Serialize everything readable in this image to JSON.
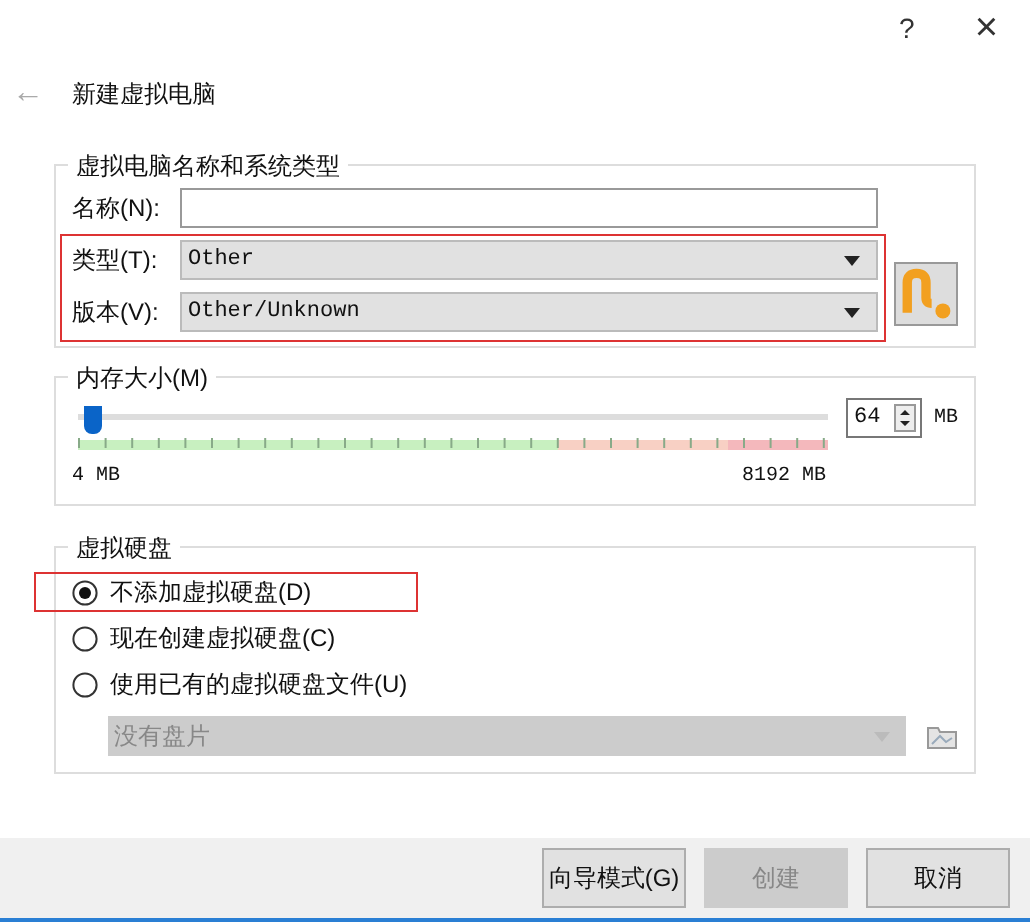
{
  "title_bar": {
    "help": "?",
    "close": "×"
  },
  "header": {
    "back": "←",
    "title": "新建虚拟电脑"
  },
  "name_type_group": {
    "title": "虚拟电脑名称和系统类型",
    "fields": [
      {
        "kind": "text",
        "label": "名称(N):",
        "highlighted": false
      },
      {
        "kind": "select",
        "label": "类型(T):",
        "value": "Other",
        "highlighted": true
      },
      {
        "kind": "select",
        "label": "版本(V):",
        "value": "Other/Unknown",
        "highlighted": true
      }
    ]
  },
  "memory_group": {
    "title": "内存大小(M)",
    "level": 0.0073,
    "value": "64",
    "unit": "MB",
    "min_label": "4 MB",
    "max_label": "8192 MB"
  },
  "disk_group": {
    "title": "虚拟硬盘",
    "options": [
      {
        "label": "不添加虚拟硬盘(D)",
        "selected": true,
        "highlighted": true
      },
      {
        "label": "现在创建虚拟硬盘(C)",
        "selected": false,
        "highlighted": false
      },
      {
        "label": "使用已有的虚拟硬盘文件(U)",
        "selected": false,
        "highlighted": false
      }
    ],
    "disk_select": {
      "value": "没有盘片",
      "disabled": true
    }
  },
  "buttons": [
    {
      "label": "向导模式(G)",
      "disabled": false
    },
    {
      "label": "创建",
      "disabled": true
    },
    {
      "label": "取消",
      "disabled": false
    }
  ]
}
